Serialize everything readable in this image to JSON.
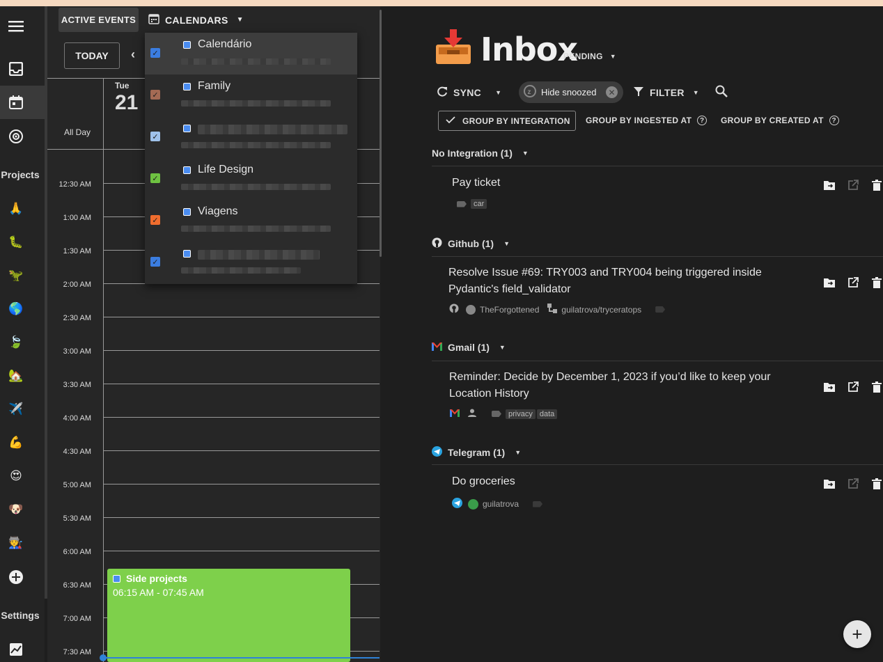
{
  "rail": {
    "projects_label": "Projects",
    "settings_label": "Settings",
    "emojis": [
      "🙏",
      "🐛",
      "🦖",
      "🌎",
      "🍃",
      "🏡",
      "✈️",
      "💪",
      "😍",
      "🐶",
      "🧑‍🏭"
    ]
  },
  "calendar": {
    "active_events_label": "ACTIVE EVENTS",
    "calendars_label": "CALENDARS",
    "today_label": "TODAY",
    "day_name": "Tue",
    "day_number": "21",
    "all_day_label": "All Day",
    "time_labels": [
      "12:30 AM",
      "1:00 AM",
      "1:30 AM",
      "2:00 AM",
      "2:30 AM",
      "3:00 AM",
      "3:30 AM",
      "4:00 AM",
      "4:30 AM",
      "5:00 AM",
      "5:30 AM",
      "6:00 AM",
      "6:30 AM",
      "7:00 AM",
      "7:30 AM"
    ],
    "event": {
      "title": "Side projects",
      "time": "06:15 AM - 07:45 AM"
    },
    "calendar_list": [
      {
        "name": "Calendário",
        "color": "#3b7de0",
        "checked": true
      },
      {
        "name": "Family",
        "color": "#a46a54",
        "checked": true
      },
      {
        "name": "",
        "color": "#9fc1ea",
        "checked": true
      },
      {
        "name": "Life Design",
        "color": "#6ec241",
        "checked": true
      },
      {
        "name": "Viagens",
        "color": "#f06d2e",
        "checked": true
      },
      {
        "name": "",
        "color": "#3b7de0",
        "checked": true
      }
    ]
  },
  "inbox": {
    "title": "Inbox",
    "status_label": "PENDING",
    "sync_label": "SYNC",
    "hide_snoozed_label": "Hide snoozed",
    "filter_label": "FILTER",
    "group_by_integration": "GROUP BY INTEGRATION",
    "group_by_ingested": "GROUP BY INGESTED AT",
    "group_by_created": "GROUP BY CREATED AT",
    "sections": [
      {
        "name": "No Integration (1)",
        "items": [
          {
            "title": "Pay ticket",
            "tags": [
              "car"
            ]
          }
        ]
      },
      {
        "name": "Github (1)",
        "items": [
          {
            "title_line1": "Resolve Issue #69: TRY003 and TRY004 being triggered inside",
            "title_line2": "Pydantic's field_validator",
            "user": "TheForgottened",
            "repo": "guilatrova/tryceratops"
          }
        ]
      },
      {
        "name": "Gmail (1)",
        "items": [
          {
            "title_line1": "Reminder: Decide by December 1, 2023 if you’d like to keep your",
            "title_line2": "Location History",
            "tags": [
              "privacy",
              "data"
            ]
          }
        ]
      },
      {
        "name": "Telegram (1)",
        "items": [
          {
            "title": "Do groceries",
            "user": "guilatrova"
          }
        ]
      }
    ]
  }
}
